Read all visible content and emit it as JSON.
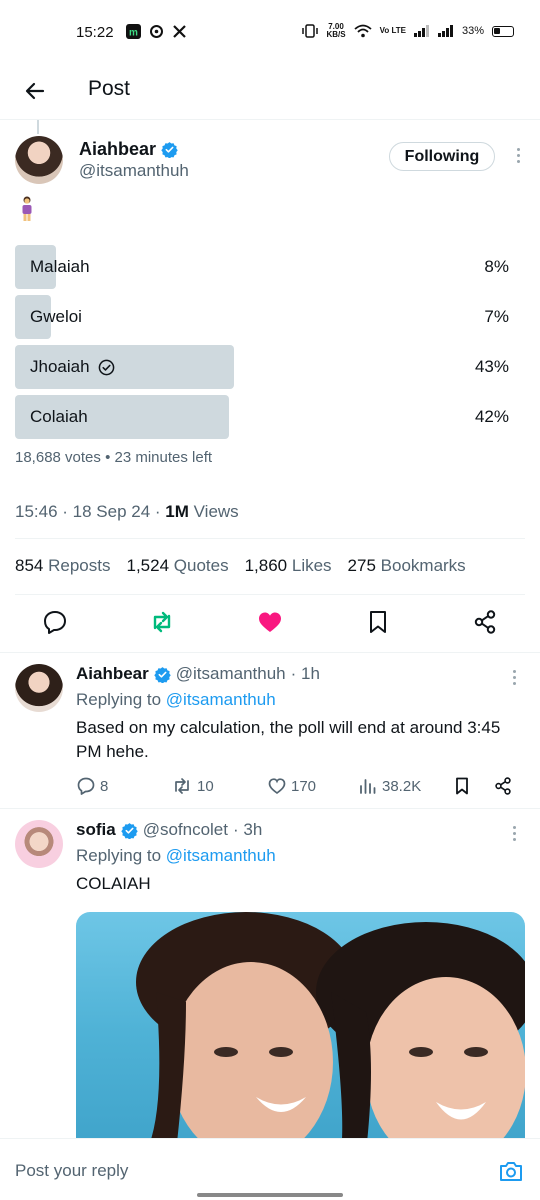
{
  "status_bar": {
    "time": "15:22",
    "speed_value": "7.00",
    "speed_unit": "KB/S",
    "network": "Vo LTE",
    "battery": "33%"
  },
  "header": {
    "title": "Post"
  },
  "tweet": {
    "author_name": "Aiahbear",
    "author_handle": "@itsamanthuh",
    "follow_label": "Following",
    "poll": {
      "options": [
        {
          "label": "Malaiah",
          "percent": "8%",
          "value": 8,
          "selected": false
        },
        {
          "label": "Gweloi",
          "percent": "7%",
          "value": 7,
          "selected": false
        },
        {
          "label": "Jhoaiah",
          "percent": "43%",
          "value": 43,
          "selected": true
        },
        {
          "label": "Colaiah",
          "percent": "42%",
          "value": 42,
          "selected": false
        }
      ],
      "meta": "18,688 votes • 23 minutes left"
    },
    "time": "15:46",
    "date": "18 Sep 24",
    "views_count": "1M",
    "views_label": "Views",
    "stats": {
      "reposts_count": "854",
      "reposts_label": "Reposts",
      "quotes_count": "1,524",
      "quotes_label": "Quotes",
      "likes_count": "1,860",
      "likes_label": "Likes",
      "bookmarks_count": "275",
      "bookmarks_label": "Bookmarks"
    },
    "colors": {
      "repost": "#00ba7c",
      "like": "#f91880",
      "verified": "#1d9bf0"
    }
  },
  "replies": [
    {
      "name": "Aiahbear",
      "handle": "@itsamanthuh",
      "time": "· 1h",
      "replying_prefix": "Replying to",
      "replying_to": "@itsamanthuh",
      "text": "Based on my calculation, the poll will end at around 3:45 PM hehe.",
      "reply_count": "8",
      "repost_count": "10",
      "like_count": "170",
      "views_count": "38.2K"
    },
    {
      "name": "sofia",
      "handle": "@sofncolet",
      "time": "· 3h",
      "replying_prefix": "Replying to",
      "replying_to": "@itsamanthuh",
      "text": "COLAIAH"
    }
  ],
  "reply_bar": {
    "placeholder": "Post your reply"
  }
}
